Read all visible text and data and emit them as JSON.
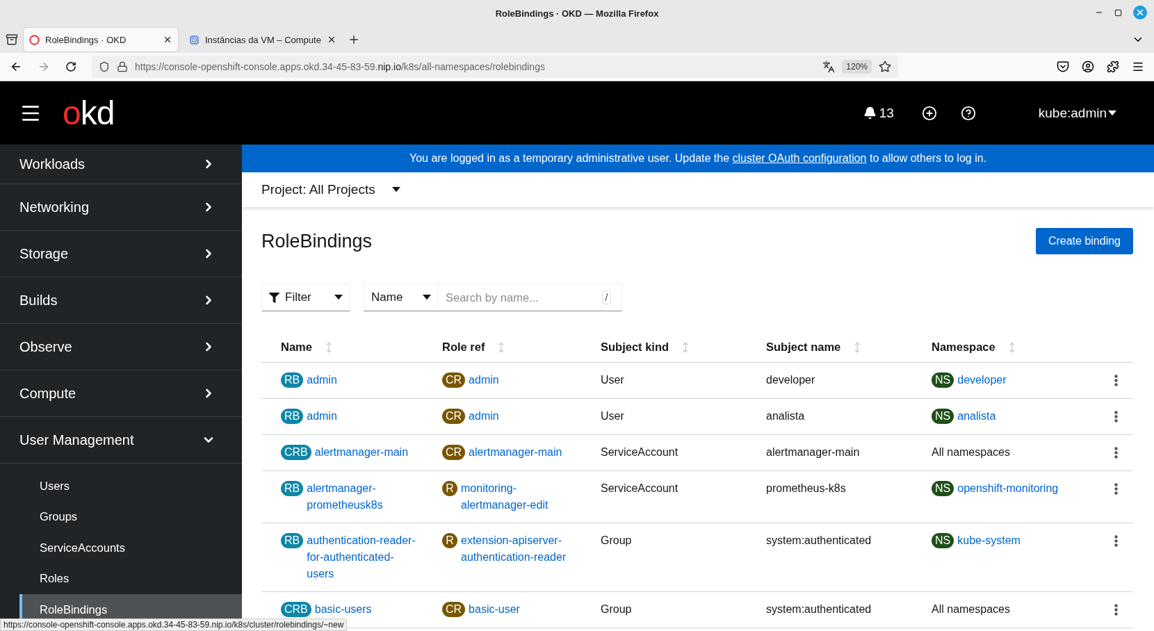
{
  "window": {
    "title": "RoleBindings · OKD — Mozilla Firefox"
  },
  "browser_tabs": [
    {
      "title": "RoleBindings · OKD",
      "selected": true
    },
    {
      "title": "Instâncias da VM – Compute",
      "selected": false
    }
  ],
  "address_bar": {
    "url_start": "https://console-openshift-console.apps.okd.34-45-83-59.",
    "url_domain": "nip.io",
    "url_end": "/k8s/all-namespaces/rolebindings",
    "zoom": "120%"
  },
  "masthead": {
    "logo_accent": "o",
    "logo_rest": "kd",
    "notifications": "13",
    "user": "kube:admin"
  },
  "sidebar": {
    "items": [
      {
        "label": "Workloads",
        "expanded": false
      },
      {
        "label": "Networking",
        "expanded": false
      },
      {
        "label": "Storage",
        "expanded": false
      },
      {
        "label": "Builds",
        "expanded": false
      },
      {
        "label": "Observe",
        "expanded": false
      },
      {
        "label": "Compute",
        "expanded": false
      },
      {
        "label": "User Management",
        "expanded": true,
        "children": [
          {
            "label": "Users",
            "selected": false
          },
          {
            "label": "Groups",
            "selected": false
          },
          {
            "label": "ServiceAccounts",
            "selected": false
          },
          {
            "label": "Roles",
            "selected": false
          },
          {
            "label": "RoleBindings",
            "selected": true
          }
        ]
      }
    ]
  },
  "banner": {
    "before": "You are logged in as a temporary administrative user. Update the ",
    "link": "cluster OAuth configuration",
    "after": " to allow others to log in."
  },
  "project_selector": "Project: All Projects",
  "page_title": "RoleBindings",
  "create_button": "Create binding",
  "toolbar": {
    "filter": "Filter",
    "search_type": "Name",
    "search_placeholder": "Search by name...",
    "shortcut": "/"
  },
  "table": {
    "columns": [
      "Name",
      "Role ref",
      "Subject kind",
      "Subject name",
      "Namespace"
    ],
    "rows": [
      {
        "name": {
          "badge": "RB",
          "color": "#0e86a6",
          "text": "admin"
        },
        "role_ref": {
          "badge": "CR",
          "color": "#795600",
          "text": "admin"
        },
        "subject_kind": "User",
        "subject_name": "developer",
        "namespace": {
          "badge": "NS",
          "color": "#1e4f18",
          "text": "developer"
        }
      },
      {
        "name": {
          "badge": "RB",
          "color": "#0e86a6",
          "text": "admin"
        },
        "role_ref": {
          "badge": "CR",
          "color": "#795600",
          "text": "admin"
        },
        "subject_kind": "User",
        "subject_name": "analista",
        "namespace": {
          "badge": "NS",
          "color": "#1e4f18",
          "text": "analista"
        }
      },
      {
        "name": {
          "badge": "CRB",
          "color": "#0e86a6",
          "text": "alertmanager-main"
        },
        "role_ref": {
          "badge": "CR",
          "color": "#795600",
          "text": "alertmanager-main"
        },
        "subject_kind": "ServiceAccount",
        "subject_name": "alertmanager-main",
        "namespace": {
          "text": "All namespaces"
        }
      },
      {
        "name": {
          "badge": "RB",
          "color": "#0e86a6",
          "text": "alertmanager-prometheusk8s"
        },
        "role_ref": {
          "badge": "R",
          "color": "#795600",
          "text": "monitoring-alertmanager-edit"
        },
        "subject_kind": "ServiceAccount",
        "subject_name": "prometheus-k8s",
        "namespace": {
          "badge": "NS",
          "color": "#1e4f18",
          "text": "openshift-monitoring"
        }
      },
      {
        "name": {
          "badge": "RB",
          "color": "#0e86a6",
          "text": "authentication-reader-for-authenticated-users"
        },
        "role_ref": {
          "badge": "R",
          "color": "#795600",
          "text": "extension-apiserver-authentication-reader"
        },
        "subject_kind": "Group",
        "subject_name": "system:authenticated",
        "namespace": {
          "badge": "NS",
          "color": "#1e4f18",
          "text": "kube-system"
        }
      },
      {
        "name": {
          "badge": "CRB",
          "color": "#0e86a6",
          "text": "basic-users"
        },
        "role_ref": {
          "badge": "CR",
          "color": "#795600",
          "text": "basic-user"
        },
        "subject_kind": "Group",
        "subject_name": "system:authenticated",
        "namespace": {
          "text": "All namespaces"
        }
      }
    ]
  },
  "status_link": "https://console-openshift-console.apps.okd.34-45-83-59.nip.io/k8s/cluster/rolebindings/~new"
}
